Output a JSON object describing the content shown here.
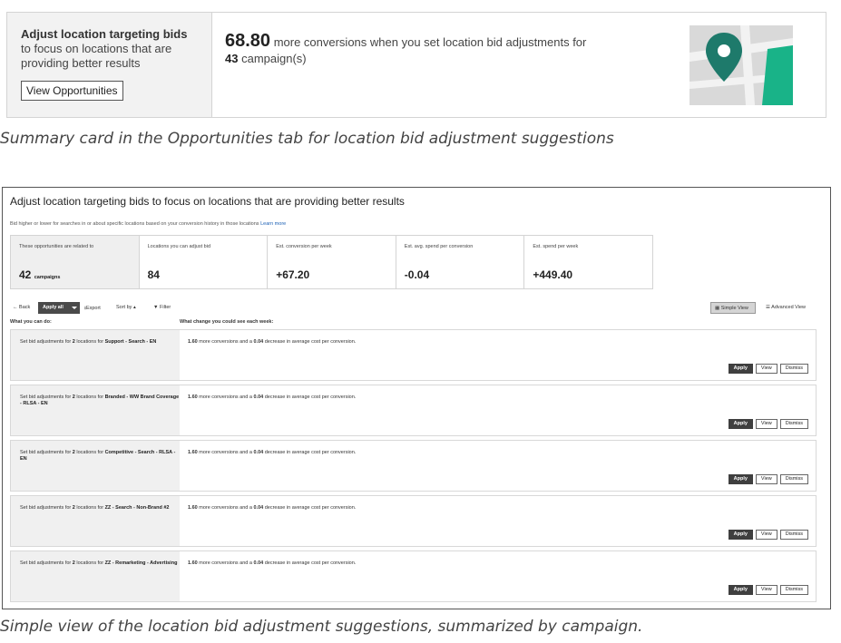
{
  "summary_card": {
    "title": "Adjust location targeting bids",
    "body_line1": "to focus on locations that are",
    "body_line2": "providing better results",
    "button_label": "View Opportunities",
    "conversions": "68.80",
    "conversions_text": "more conversions when you set location bid adjustments for",
    "campaign_count": "43",
    "campaign_text": "campaign(s)",
    "illustration_icon": "map-pin-icon",
    "colors": {
      "pin": "#1e7a6b",
      "green_area": "#19b388",
      "map_bg": "#d9d9d9"
    }
  },
  "caption_top": "Summary card in the Opportunities tab for location bid adjustment suggestions",
  "panel": {
    "title": "Adjust location targeting bids to focus on locations that are providing better results",
    "subtitle": "Bid higher or lower for searches in or about specific locations based on your conversion history in those locations",
    "learn_more": "Learn more",
    "stats": [
      {
        "label": "These opportunities are related to",
        "value": "42",
        "suffix": "campaigns"
      },
      {
        "label": "Locations you can adjust bid",
        "value": "84",
        "suffix": ""
      },
      {
        "label": "Est. conversion per week",
        "value": "+67.20",
        "suffix": ""
      },
      {
        "label": "Est. avg. spend per conversion",
        "value": "-0.04",
        "suffix": ""
      },
      {
        "label": "Est. spend per week",
        "value": "+449.40",
        "suffix": ""
      }
    ],
    "toolbar": {
      "back": "Back",
      "apply_all": "Apply all",
      "export": "Export",
      "sort_by": "Sort by",
      "filter": "Filter",
      "simple_view": "Simple View",
      "advanced_view": "Advanced View"
    },
    "col_left": "What you can do:",
    "col_right": "What change you could see each week:",
    "rows": [
      {
        "pre": "Set bid adjustments for ",
        "count": "2",
        "mid": " locations for ",
        "campaign": "Support - Search - EN",
        "conv": "1.60",
        "conv_text": " more conversions and a ",
        "dec": "0.04",
        "dec_text": " decrease in average cost per conversion."
      },
      {
        "pre": "Set bid adjustments for ",
        "count": "2",
        "mid": " locations for ",
        "campaign": "Branded - WW Brand Coverage - RLSA - EN",
        "conv": "1.60",
        "conv_text": " more conversions and a ",
        "dec": "0.04",
        "dec_text": " decrease in average cost per conversion."
      },
      {
        "pre": "Set bid adjustments for ",
        "count": "2",
        "mid": " locations for ",
        "campaign": "Competitive - Search - RLSA - EN",
        "conv": "1.60",
        "conv_text": " more conversions and a ",
        "dec": "0.04",
        "dec_text": " decrease in average cost per conversion."
      },
      {
        "pre": "Set bid adjustments for ",
        "count": "2",
        "mid": " locations for ",
        "campaign": "ZZ - Search - Non-Brand #2",
        "conv": "1.60",
        "conv_text": " more conversions and a ",
        "dec": "0.04",
        "dec_text": " decrease in average cost per conversion."
      },
      {
        "pre": "Set bid adjustments for ",
        "count": "2",
        "mid": " locations for ",
        "campaign": "ZZ - Remarketing - Advertising",
        "conv": "1.60",
        "conv_text": " more conversions and a ",
        "dec": "0.04",
        "dec_text": " decrease in average cost per conversion."
      }
    ],
    "row_buttons": {
      "apply": "Apply",
      "view": "View",
      "dismiss": "Dismiss"
    }
  },
  "caption_bottom": "Simple view of the location bid adjustment suggestions, summarized by campaign."
}
